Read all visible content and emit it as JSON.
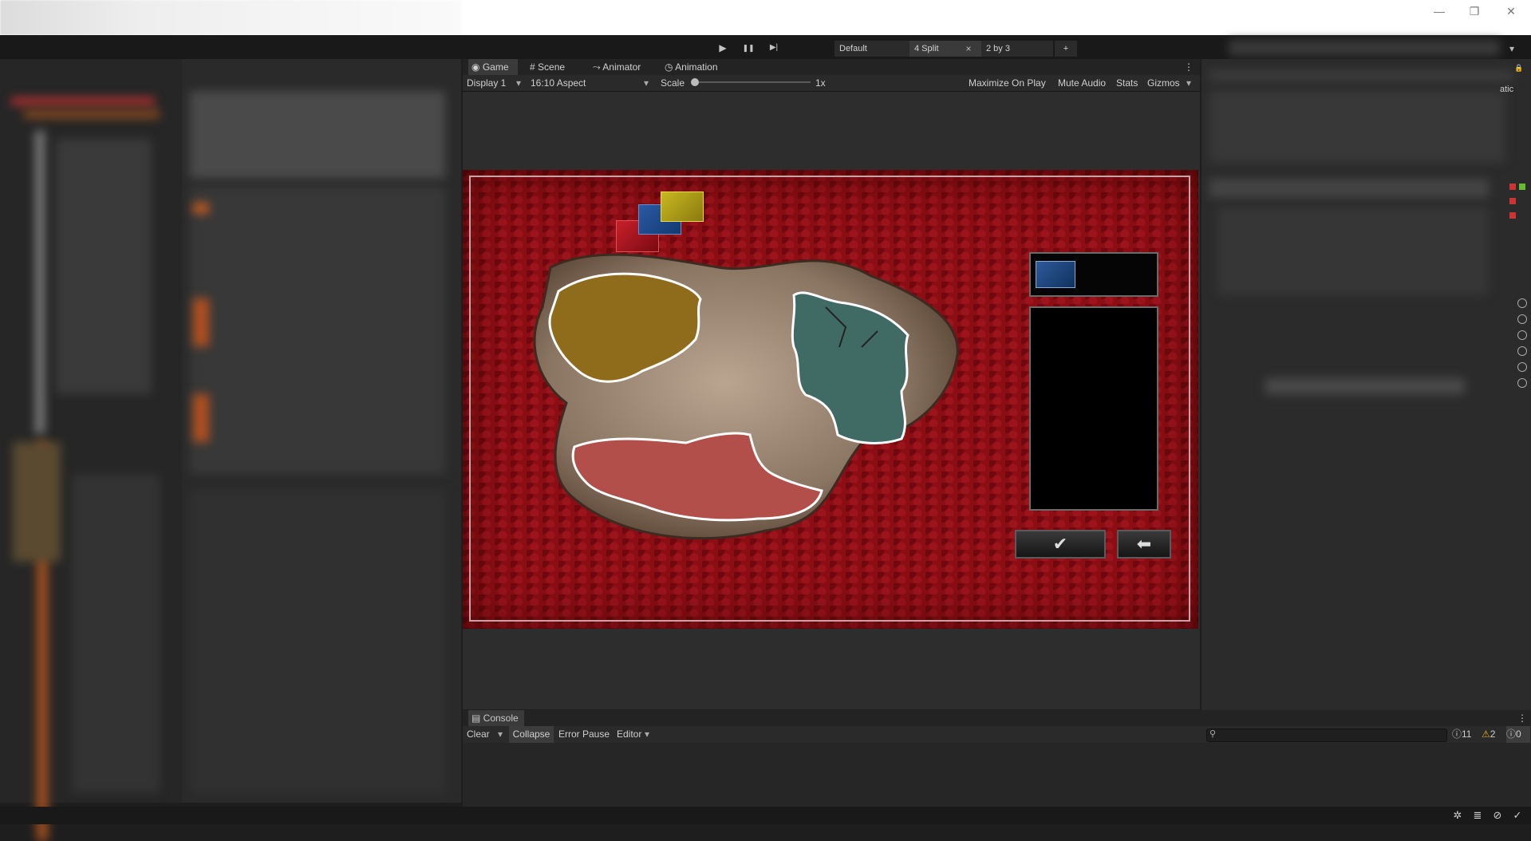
{
  "window": {
    "minimize_glyph": "—",
    "restore_glyph": "❐",
    "close_glyph": "✕"
  },
  "toolbar": {
    "play_glyph": "▶",
    "pause_glyph": "❚❚",
    "step_glyph": "▶|",
    "layouts": [
      {
        "label": "Default"
      },
      {
        "label": "4 Split"
      },
      {
        "label": "2 by 3"
      }
    ],
    "close_tab_glyph": "×",
    "add_layout_glyph": "+",
    "overflow_glyph": "▾"
  },
  "view_tabs": {
    "game": "Game",
    "scene": "Scene",
    "animator": "Animator",
    "animation": "Animation",
    "menu_glyph": "⋮"
  },
  "game_toolbar": {
    "display": "Display 1",
    "aspect": "16:10 Aspect",
    "scale_label": "Scale",
    "scale_value": "1x",
    "maximize_on_play": "Maximize On Play",
    "mute_audio": "Mute Audio",
    "stats": "Stats",
    "gizmos": "Gizmos",
    "dropdown_glyph": "▾"
  },
  "game": {
    "confirm_glyph": "✔",
    "back_glyph": "⬅"
  },
  "inspector": {
    "static_label": "atic",
    "lock_glyph": "🔒"
  },
  "console": {
    "tab": "Console",
    "clear": "Clear",
    "collapse": "Collapse",
    "error_pause": "Error Pause",
    "editor": "Editor",
    "search_glyph": "⚲",
    "info_count": "11",
    "warning_count": "2",
    "error_count": "0",
    "menu_glyph": "⋮"
  },
  "statusbar": {
    "icons": [
      "bug-icon",
      "stack-icon",
      "network-icon",
      "check-circle-icon"
    ]
  }
}
